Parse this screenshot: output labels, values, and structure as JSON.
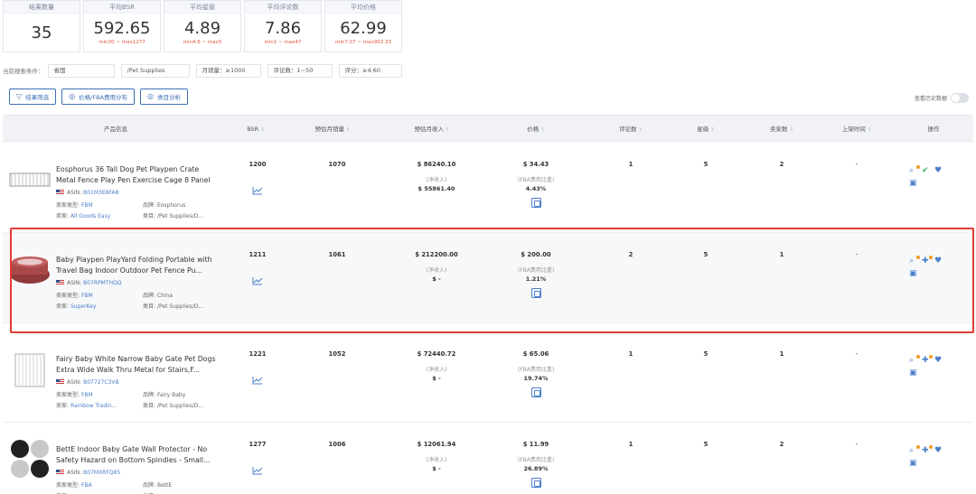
{
  "stats": [
    {
      "label": "结果数量",
      "value": "35",
      "range": ""
    },
    {
      "label": "平均BSR",
      "value": "592.65",
      "range": "min30 ~ max1277"
    },
    {
      "label": "平均星级",
      "value": "4.89",
      "range": "min4.6 ~ max5"
    },
    {
      "label": "平均评论数",
      "value": "7.86",
      "range": "min1 ~ max47"
    },
    {
      "label": "平均价格",
      "value": "62.99",
      "range": "min7.07 ~ max902.33"
    }
  ],
  "filters": {
    "label": "当前搜索条件：",
    "items": [
      "省国",
      "/Pet Supplies",
      "月销量：≥1000",
      "评论数：1~50",
      "评分：≥4.60"
    ]
  },
  "toolbar": {
    "filter_btn": "结果筛选",
    "fba_btn": "价格/FBA费用分布",
    "analysis_btn": "类目分析",
    "toggle_label": "查看历史数据"
  },
  "columns": [
    "产品信息",
    "BSR",
    "预估月销量",
    "预估月收入",
    "价格",
    "评论数",
    "星级",
    "卖家数",
    "上架时间",
    "操作"
  ],
  "labels": {
    "asin": "ASIN:",
    "seller_type": "卖家类型:",
    "brand": "品牌:",
    "seller": "卖家:",
    "category": "类目:",
    "net_income": "(净收入)",
    "fba_ratio": "(FBA费用比重)"
  },
  "icons": {
    "trend": "trend-chart-icon",
    "fee": "fee-detail-icon",
    "search_plus": "search-plus-icon",
    "check": "check-icon",
    "puzzle": "puzzle-icon",
    "heart": "heart-icon",
    "calendar": "calendar-icon"
  },
  "colors": {
    "accent": "#3d6fb4",
    "link": "#4a7fc9",
    "highlight": "#e23b34",
    "range": "#e0533c"
  },
  "rows": [
    {
      "title": "Eosphorus 36 Tall Dog Pet Playpen Crate Metal Fence Play Pen Exercise Cage 8 Panel ...",
      "asin": "B01M3E8FA8",
      "seller_type": "FBM",
      "brand": "Eosphorus",
      "seller": "All Goods Easy",
      "category": "/Pet Supplies/D...",
      "bsr": "1200",
      "sales": "1070",
      "revenue": "$ 86240.10",
      "net": "$ 55861.40",
      "price": "$ 34.43",
      "fba": "4.43%",
      "reviews": "1",
      "stars": "5",
      "sellers": "2",
      "date": "-",
      "ops": [
        "search_plus",
        "check",
        "heart",
        "calendar"
      ]
    },
    {
      "title": "Baby Playpen PlayYard Folding Portable with Travel Bag Indoor Outdoor Pet Fence Pu...",
      "asin": "B07RPMTHQQ",
      "seller_type": "FBM",
      "brand": "China",
      "seller": "SuperKey",
      "category": "/Pet Supplies/D...",
      "bsr": "1211",
      "sales": "1061",
      "revenue": "$ 212200.00",
      "net": "$ -",
      "price": "$ 200.00",
      "fba": "1.21%",
      "reviews": "2",
      "stars": "5",
      "sellers": "1",
      "date": "-",
      "ops": [
        "search_plus",
        "puzzle",
        "heart",
        "calendar"
      ]
    },
    {
      "title": "Fairy Baby White Narrow Baby Gate Pet Dogs Extra Wide Walk Thru Metal for Stairs,F...",
      "asin": "B07727C3V8",
      "seller_type": "FBM",
      "brand": "Fairy Baby",
      "seller": "Rainbow Tradin...",
      "category": "/Pet Supplies/D...",
      "bsr": "1221",
      "sales": "1052",
      "revenue": "$ 72440.72",
      "net": "$ -",
      "price": "$ 65.06",
      "fba": "19.74%",
      "reviews": "1",
      "stars": "5",
      "sellers": "1",
      "date": "-",
      "ops": [
        "search_plus",
        "puzzle",
        "heart",
        "calendar"
      ]
    },
    {
      "title": "BettE Indoor Baby Gate Wall Protector - No Safety Hazard on Bottom Spindles - Small...",
      "asin": "B07MXRFQ85",
      "seller_type": "FBA",
      "brand": "BettE",
      "seller": "",
      "category": "",
      "bsr": "1277",
      "sales": "1006",
      "revenue": "$ 12061.94",
      "net": "$ -",
      "price": "$ 11.99",
      "fba": "26.89%",
      "reviews": "1",
      "stars": "5",
      "sellers": "2",
      "date": "-",
      "ops": [
        "search_plus",
        "puzzle",
        "heart",
        "calendar"
      ]
    }
  ]
}
